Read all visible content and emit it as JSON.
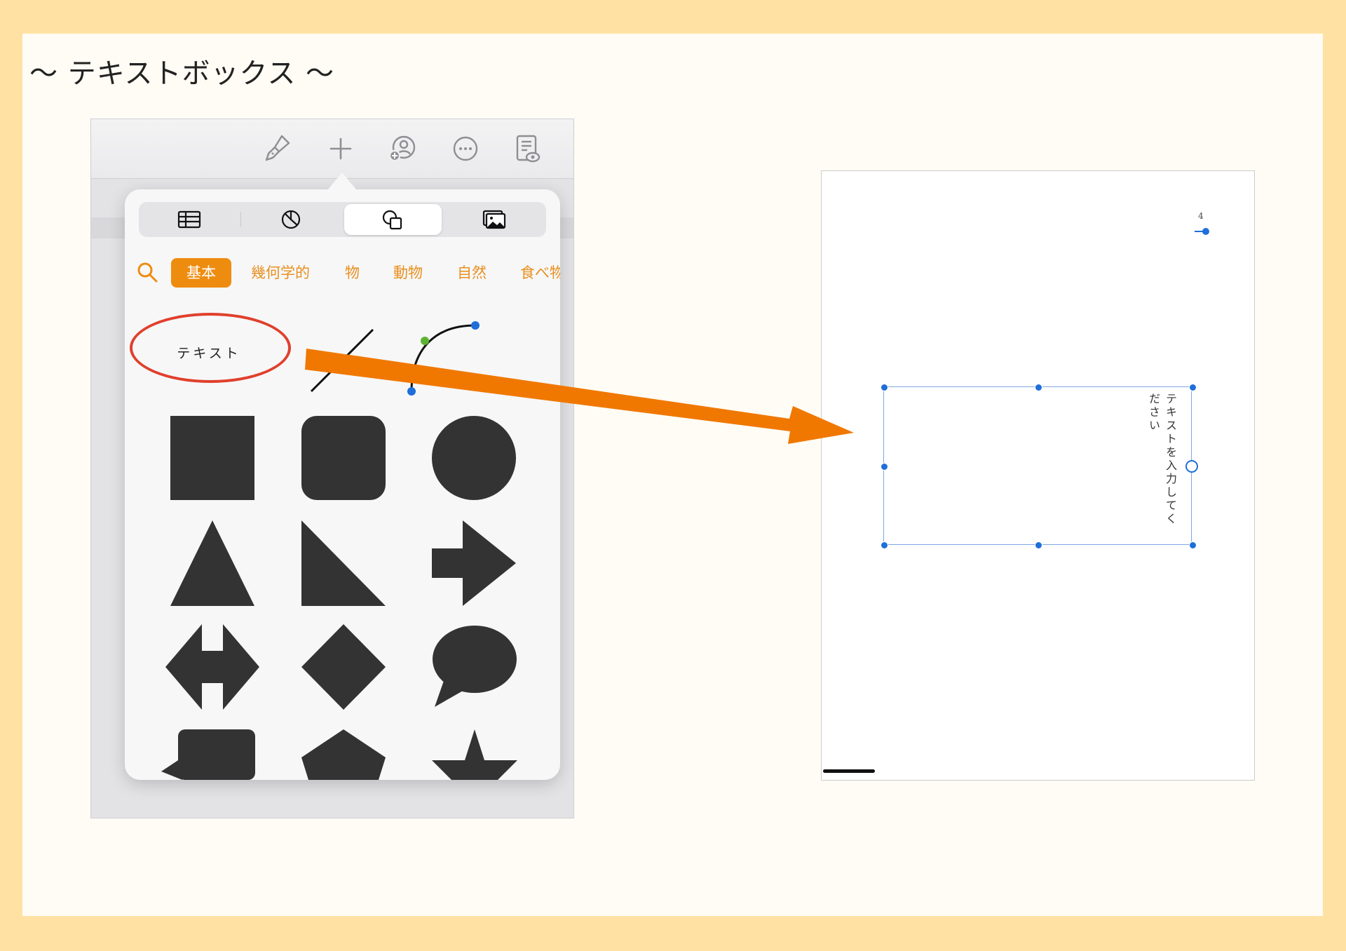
{
  "page_title": "～ テキストボックス ～",
  "toolbar": {
    "icons": [
      "paintbrush-icon",
      "plus-icon",
      "collaborate-icon",
      "more-icon",
      "document-preview-icon"
    ]
  },
  "insert_popover": {
    "segments": [
      {
        "name": "table-icon",
        "active": false
      },
      {
        "name": "chart-icon",
        "active": false
      },
      {
        "name": "shapes-icon",
        "active": true
      },
      {
        "name": "media-icon",
        "active": false
      }
    ],
    "categories": [
      "基本",
      "幾何学的",
      "物",
      "動物",
      "自然",
      "食べ物"
    ],
    "active_category": "基本",
    "text_shape_label": "テキスト"
  },
  "document": {
    "page_number": "4",
    "textbox_text": "テキストを入力してください"
  },
  "colors": {
    "accent_orange": "#EE8C10",
    "arrow_orange": "#F07800",
    "highlight_red": "#E0402C",
    "selection_blue": "#1E6FD9",
    "shape_fill": "#333333"
  }
}
